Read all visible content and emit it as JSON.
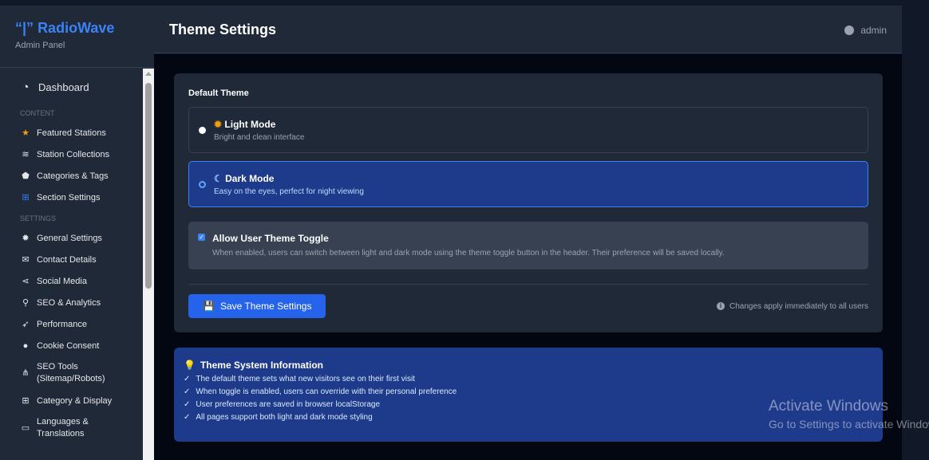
{
  "brand": {
    "name": "RadioWave",
    "subtitle": "Admin Panel"
  },
  "sidebar": {
    "dashboard": "Dashboard",
    "content_label": "CONTENT",
    "content_items": [
      {
        "label": "Featured Stations",
        "icon": "★",
        "color": "#f59e0b",
        "name": "star-icon"
      },
      {
        "label": "Station Collections",
        "icon": "≋",
        "color": "#e5e7eb",
        "name": "layers-icon"
      },
      {
        "label": "Categories & Tags",
        "icon": "⬟",
        "color": "#e5e7eb",
        "name": "tags-icon"
      },
      {
        "label": "Section Settings",
        "icon": "⊞",
        "color": "#3b82f6",
        "name": "grid-icon"
      }
    ],
    "settings_label": "SETTINGS",
    "settings_items": [
      {
        "label": "General Settings",
        "icon": "✹",
        "name": "gear-icon"
      },
      {
        "label": "Contact Details",
        "icon": "✉",
        "name": "envelope-icon"
      },
      {
        "label": "Social Media",
        "icon": "⋖",
        "name": "share-icon"
      },
      {
        "label": "SEO & Analytics",
        "icon": "⚲",
        "name": "search-icon"
      },
      {
        "label": "Performance",
        "icon": "➶",
        "name": "rocket-icon"
      },
      {
        "label": "Cookie Consent",
        "icon": "●",
        "name": "cookie-icon"
      },
      {
        "label": "SEO Tools (Sitemap/Robots)",
        "icon": "⋔",
        "name": "sitemap-icon"
      },
      {
        "label": "Category & Display",
        "icon": "⊞",
        "name": "grid-icon"
      },
      {
        "label": "Languages & Translations",
        "icon": "▭",
        "name": "language-icon"
      }
    ]
  },
  "header": {
    "title": "Theme Settings",
    "user": "admin"
  },
  "theme": {
    "default_label": "Default Theme",
    "options": [
      {
        "title": "Light Mode",
        "desc": "Bright and clean interface",
        "selected": false
      },
      {
        "title": "Dark Mode",
        "desc": "Easy on the eyes, perfect for night viewing",
        "selected": true
      }
    ],
    "toggle": {
      "title": "Allow User Theme Toggle",
      "desc": "When enabled, users can switch between light and dark mode using the theme toggle button in the header. Their preference will be saved locally.",
      "checked": true
    },
    "save_label": "Save Theme Settings",
    "note": "Changes apply immediately to all users"
  },
  "info": {
    "title": "Theme System Information",
    "items": [
      "The default theme sets what new visitors see on their first visit",
      "When toggle is enabled, users can override with their personal preference",
      "User preferences are saved in browser localStorage",
      "All pages support both light and dark mode styling"
    ]
  },
  "watermark": {
    "title": "Activate Windows",
    "subtitle": "Go to Settings to activate Windows."
  }
}
